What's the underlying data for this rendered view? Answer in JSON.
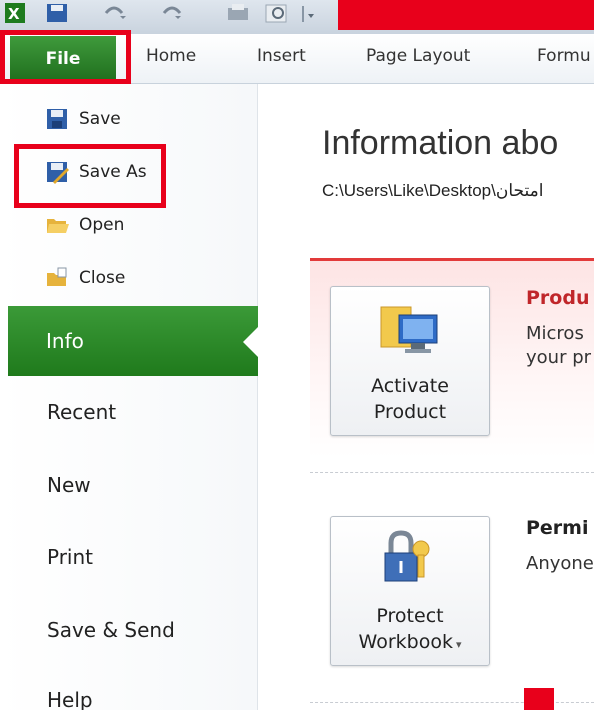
{
  "ribbon": {
    "tabs": [
      {
        "label": "File"
      },
      {
        "label": "Home"
      },
      {
        "label": "Insert"
      },
      {
        "label": "Page Layout"
      },
      {
        "label": "Formu"
      }
    ]
  },
  "backstage": {
    "commands": [
      {
        "label": "Save",
        "icon": "save-icon"
      },
      {
        "label": "Save As",
        "icon": "save-as-icon"
      },
      {
        "label": "Open",
        "icon": "open-folder-icon"
      },
      {
        "label": "Close",
        "icon": "close-folder-icon"
      }
    ],
    "menu": [
      {
        "label": "Info",
        "selected": true
      },
      {
        "label": "Recent"
      },
      {
        "label": "New"
      },
      {
        "label": "Print"
      },
      {
        "label": "Save & Send"
      },
      {
        "label": "Help"
      }
    ]
  },
  "info": {
    "title": "Information abo",
    "path": "C:\\Users\\Like\\Desktop\\امتحان",
    "product": {
      "button_line1": "Activate",
      "button_line2": "Product",
      "heading": "Produ",
      "text_line1": "Micros",
      "text_line2": "your pr"
    },
    "permissions": {
      "button_line1": "Protect",
      "button_line2": "Workbook",
      "heading": "Permi",
      "text_line1": "Anyone"
    }
  },
  "colors": {
    "file_tab_green": "#2e8b2a",
    "highlight_red": "#e8001b",
    "product_panel_border": "#e23a3a"
  }
}
